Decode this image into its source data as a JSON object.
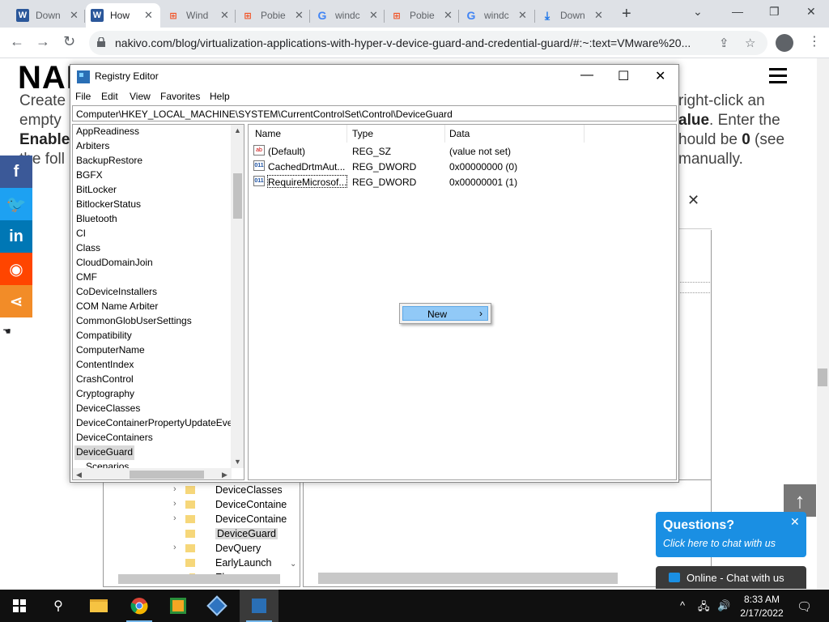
{
  "browser": {
    "tabs": [
      {
        "title": "Down",
        "icon": "word-icon"
      },
      {
        "title": "How",
        "icon": "word-icon",
        "active": true
      },
      {
        "title": "Wind",
        "icon": "windows-icon"
      },
      {
        "title": "Pobie",
        "icon": "windows-icon"
      },
      {
        "title": "windc",
        "icon": "google-icon"
      },
      {
        "title": "Pobie",
        "icon": "windows-icon"
      },
      {
        "title": "windc",
        "icon": "google-icon"
      },
      {
        "title": "Down",
        "icon": "download-icon"
      }
    ],
    "url": "nakivo.com/blog/virtualization-applications-with-hyper-v-device-guard-and-credential-guard/#:~:text=VMware%20..."
  },
  "page": {
    "logo": "NAKIVO",
    "article_lines": [
      {
        "left": "Create",
        "right": "right-click an"
      },
      {
        "left": "empty",
        "right_bold": "alue",
        "right": ". Enter the"
      },
      {
        "left_bold": "EnableV",
        "right": "hould be ",
        "right_bold2": "0",
        "right_tail": " (see"
      },
      {
        "left": "the foll",
        "right": "manually."
      }
    ],
    "bg_tree_items": [
      "DeviceClasses",
      "DeviceContaine",
      "DeviceContaine",
      "DeviceGuard",
      "DevQuery",
      "EarlyLaunch",
      "Els"
    ],
    "chat": {
      "title": "Questions?",
      "subtitle": "Click here to chat with us",
      "bar": "Online - Chat with us"
    }
  },
  "regedit": {
    "title": "Registry Editor",
    "menu": [
      "File",
      "Edit",
      "View",
      "Favorites",
      "Help"
    ],
    "address": "Computer\\HKEY_LOCAL_MACHINE\\SYSTEM\\CurrentControlSet\\Control\\DeviceGuard",
    "tree": [
      "AppReadiness",
      "Arbiters",
      "BackupRestore",
      "BGFX",
      "BitLocker",
      "BitlockerStatus",
      "Bluetooth",
      "CI",
      "Class",
      "CloudDomainJoin",
      "CMF",
      "CoDeviceInstallers",
      "COM Name Arbiter",
      "CommonGlobUserSettings",
      "Compatibility",
      "ComputerName",
      "ContentIndex",
      "CrashControl",
      "Cryptography",
      "DeviceClasses",
      "DeviceContainerPropertyUpdateEven",
      "DeviceContainers",
      "DeviceGuard",
      "Scenarios"
    ],
    "selected_key": "DeviceGuard",
    "columns": [
      "Name",
      "Type",
      "Data"
    ],
    "values": [
      {
        "name": "(Default)",
        "type": "REG_SZ",
        "data": "(value not set)",
        "icon": "string-value-icon"
      },
      {
        "name": "CachedDrtmAut...",
        "type": "REG_DWORD",
        "data": "0x00000000 (0)",
        "icon": "dword-value-icon"
      },
      {
        "name": "RequireMicrosof...",
        "type": "REG_DWORD",
        "data": "0x00000001 (1)",
        "icon": "dword-value-icon"
      }
    ],
    "context_menu": {
      "item": "New",
      "arrow": "›"
    }
  },
  "taskbar": {
    "time": "8:33 AM",
    "date": "2/17/2022"
  },
  "colors": {
    "accent": "#1a8fe3",
    "facebook": "#3b5998",
    "twitter": "#1da1f2",
    "linkedin": "#0077b5",
    "reddit": "#ff4500",
    "share": "#f28c28"
  }
}
